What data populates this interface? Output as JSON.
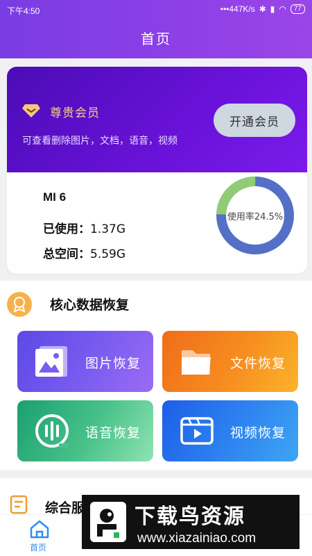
{
  "status_bar": {
    "time": "下午4:50",
    "network": "•••447K/s",
    "battery": "77"
  },
  "header": {
    "title": "首页"
  },
  "vip": {
    "label": "尊贵会员",
    "description": "可查看删除图片，文档，语音，视频",
    "button": "开通会员"
  },
  "device": {
    "name": "MI 6",
    "used_label": "已使用：",
    "used_value": "1.37G",
    "total_label": "总空间：",
    "total_value": "5.59G",
    "usage_text": "使用率24.5%",
    "usage_fraction": 0.245
  },
  "core": {
    "title": "核心数据恢复",
    "tiles": [
      {
        "label": "图片恢复",
        "icon": "image-icon"
      },
      {
        "label": "文件恢复",
        "icon": "folder-icon"
      },
      {
        "label": "语音恢复",
        "icon": "voice-icon"
      },
      {
        "label": "视频恢复",
        "icon": "video-icon"
      }
    ]
  },
  "misc": {
    "title": "综合服"
  },
  "nav": {
    "home": "首页"
  },
  "watermark": {
    "brand": "下载鸟资源",
    "url": "www.xiazainiao.com"
  },
  "colors": {
    "header_purple": "#8b3fe6",
    "vip_purple": "#5a10c8",
    "ring_blue": "#5470c6",
    "ring_green": "#91cc75",
    "nav_blue": "#2f8bf3"
  }
}
